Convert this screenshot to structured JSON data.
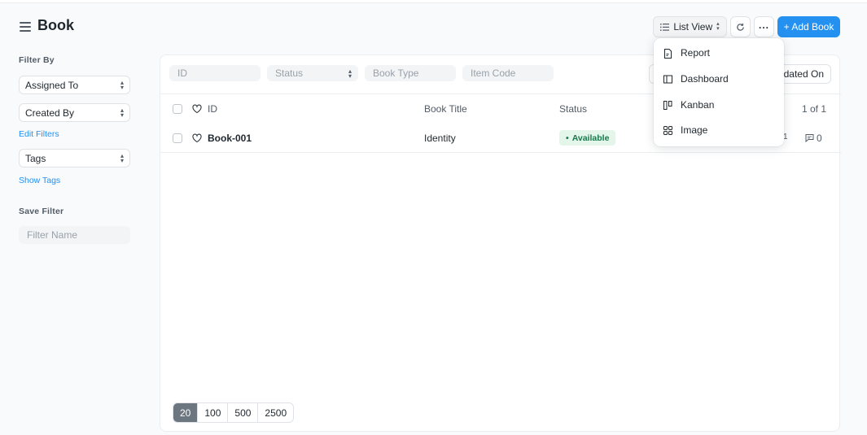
{
  "header": {
    "title": "Book",
    "view_button": "List View",
    "more_button": "...",
    "add_button": "+ Add Book"
  },
  "sidebar": {
    "filter_by_label": "Filter By",
    "assigned_to": "Assigned To",
    "created_by": "Created By",
    "edit_filters": "Edit Filters",
    "tags": "Tags",
    "show_tags": "Show Tags",
    "save_filter_label": "Save Filter",
    "filter_name_placeholder": "Filter Name"
  },
  "filters": {
    "id_placeholder": "ID",
    "status_placeholder": "Status",
    "book_type_placeholder": "Book Type",
    "item_code_placeholder": "Item Code",
    "sort_label": "odated On"
  },
  "list": {
    "columns": {
      "id": "ID",
      "title": "Book Title",
      "status": "Status"
    },
    "count": "1 of 1",
    "rows": [
      {
        "id": "Book-001",
        "title": "Identity",
        "status": "Available",
        "timestamp": "1",
        "comments": "0"
      }
    ]
  },
  "pager": {
    "sizes": [
      "20",
      "100",
      "500",
      "2500"
    ],
    "active": "20"
  },
  "dropdown": {
    "items": [
      "Report",
      "Dashboard",
      "Kanban",
      "Image"
    ]
  },
  "colors": {
    "primary": "#2490ef",
    "badge_bg": "#e4f5e9",
    "badge_text": "#16794c"
  }
}
